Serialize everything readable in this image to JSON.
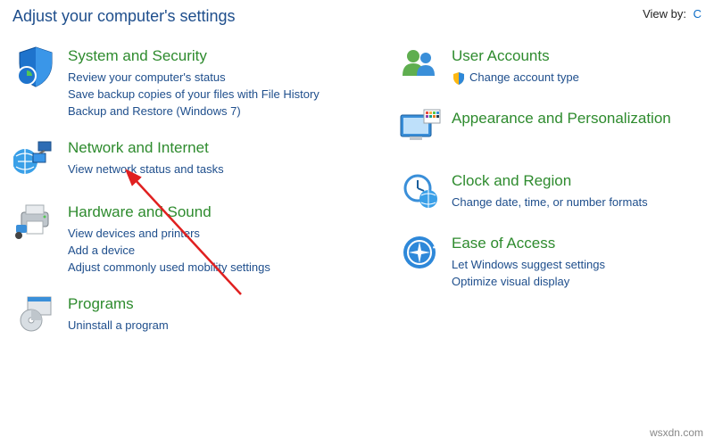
{
  "top_title": "Adjust your computer's settings",
  "view_by": {
    "label": "View by:",
    "value": "C"
  },
  "left": [
    {
      "title": "System and Security",
      "links": [
        "Review your computer's status",
        "Save backup copies of your files with File History",
        "Backup and Restore (Windows 7)"
      ],
      "icon": "shield-system-icon"
    },
    {
      "title": "Network and Internet",
      "links": [
        "View network status and tasks"
      ],
      "icon": "network-globe-icon"
    },
    {
      "title": "Hardware and Sound",
      "links": [
        "View devices and printers",
        "Add a device",
        "Adjust commonly used mobility settings"
      ],
      "icon": "printer-icon"
    },
    {
      "title": "Programs",
      "links": [
        "Uninstall a program"
      ],
      "icon": "programs-disc-icon"
    }
  ],
  "right": [
    {
      "title": "User Accounts",
      "links": [
        "Change account type"
      ],
      "icon": "user-accounts-icon",
      "mini_icon": "shield-icon"
    },
    {
      "title": "Appearance and Personalization",
      "links": [],
      "icon": "appearance-icon"
    },
    {
      "title": "Clock and Region",
      "links": [
        "Change date, time, or number formats"
      ],
      "icon": "clock-icon"
    },
    {
      "title": "Ease of Access",
      "links": [
        "Let Windows suggest settings",
        "Optimize visual display"
      ],
      "icon": "ease-of-access-icon"
    }
  ],
  "watermark": "wsxdn.com"
}
